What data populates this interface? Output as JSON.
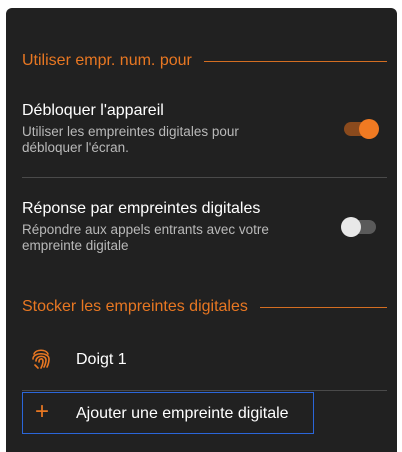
{
  "section_unlock_with": {
    "title": "Utiliser empr. num. pour"
  },
  "unlock_device": {
    "title": "Débloquer l'appareil",
    "description": "Utiliser les empreintes digitales pour débloquer l'écran.",
    "enabled": true
  },
  "call_answer": {
    "title": "Réponse par empreintes digitales",
    "description": "Répondre aux appels entrants avec votre empreinte digitale",
    "enabled": false
  },
  "section_stored": {
    "title": "Stocker les empreintes digitales"
  },
  "fingerprints": [
    {
      "label": "Doigt 1",
      "icon": "fingerprint-icon"
    }
  ],
  "add_fingerprint": {
    "label": "Ajouter une empreinte digitale",
    "icon": "plus-icon"
  },
  "colors": {
    "accent": "#e87722",
    "background": "#212121",
    "focus": "#2b66d9"
  }
}
